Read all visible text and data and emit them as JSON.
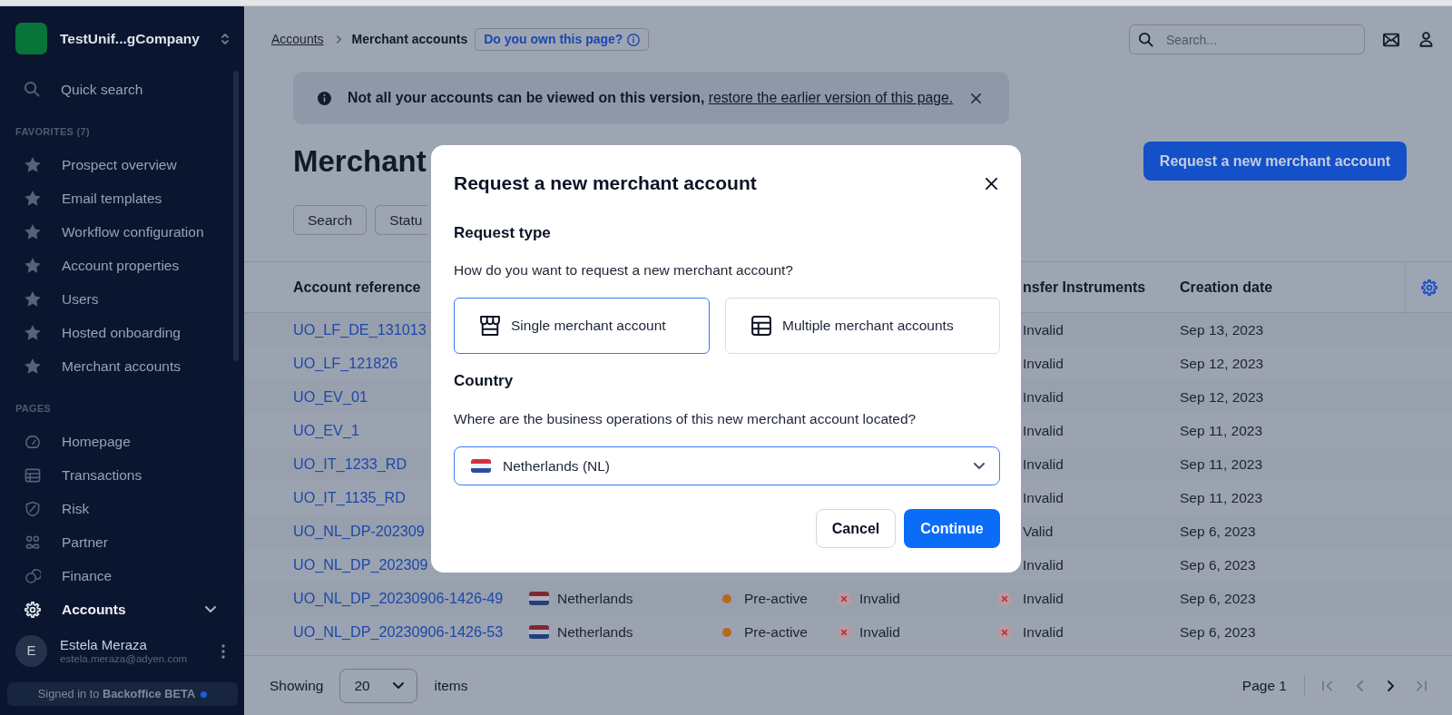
{
  "sidebar": {
    "account_name": "TestUnif...gCompany",
    "quick_search": "Quick search",
    "sections": [
      {
        "title": "FAVORITES (7)",
        "items": [
          {
            "label": "Prospect overview",
            "selected": false
          },
          {
            "label": "Email templates",
            "selected": false
          },
          {
            "label": "Workflow configuration",
            "selected": false
          },
          {
            "label": "Account properties",
            "selected": false
          },
          {
            "label": "Users",
            "selected": false
          },
          {
            "label": "Hosted onboarding",
            "selected": false
          },
          {
            "label": "Merchant accounts",
            "selected": false
          }
        ]
      },
      {
        "title": "PAGES",
        "items": [
          {
            "label": "Homepage",
            "selected": false
          },
          {
            "label": "Transactions",
            "selected": false
          },
          {
            "label": "Risk",
            "selected": false
          },
          {
            "label": "Partner",
            "selected": false
          },
          {
            "label": "Finance",
            "selected": false
          },
          {
            "label": "Accounts",
            "selected": true,
            "expanded": false
          }
        ]
      }
    ],
    "user": {
      "initial": "E",
      "name": "Estela Meraza",
      "email": "estela.meraza@adyen.com"
    },
    "signed_in": "Signed in to **Backoffice BETA**"
  },
  "topbar": {
    "breadcrumb": [
      {
        "label": "Accounts",
        "kind": "link"
      },
      {
        "label": "Merchant accounts",
        "kind": "current"
      }
    ],
    "ownership_button": "Do you own this page?",
    "search": {
      "placeholder": "Search..."
    }
  },
  "banner": {
    "message": "Not all your accounts can be viewed on this version,",
    "link": "restore the earlier version of this page."
  },
  "page": {
    "title": "Merchant",
    "primary_button": "Request a new merchant account",
    "filters": [
      "Search",
      "Statu"
    ]
  },
  "table": {
    "columns": {
      "account_reference": "Account reference",
      "transfer_instruments": "nsfer Instruments",
      "creation_date": "Creation date"
    },
    "rows": [
      {
        "account_reference": "UO_LF_DE_131013",
        "transfer_instruments": {
          "text": "Invalid"
        },
        "creation_date": "Sep 13, 2023"
      },
      {
        "account_reference": "UO_LF_121826",
        "transfer_instruments": {
          "text": "Invalid"
        },
        "creation_date": "Sep 12, 2023"
      },
      {
        "account_reference": "UO_EV_01",
        "transfer_instruments": {
          "text": "Invalid"
        },
        "creation_date": "Sep 12, 2023"
      },
      {
        "account_reference": "UO_EV_1",
        "transfer_instruments": {
          "text": "Invalid"
        },
        "creation_date": "Sep 11, 2023"
      },
      {
        "account_reference": "UO_IT_1233_RD",
        "transfer_instruments": {
          "text": "Invalid"
        },
        "creation_date": "Sep 11, 2023"
      },
      {
        "account_reference": "UO_IT_1135_RD",
        "transfer_instruments": {
          "text": "Invalid"
        },
        "creation_date": "Sep 11, 2023"
      },
      {
        "account_reference": "UO_NL_DP-202309",
        "transfer_instruments": {
          "text": "Valid"
        },
        "creation_date": "Sep 6, 2023"
      },
      {
        "account_reference": "UO_NL_DP_202309",
        "transfer_instruments": {
          "text": "Invalid"
        },
        "creation_date": "Sep 6, 2023"
      },
      {
        "account_reference": "UO_NL_DP_20230906-1426-49",
        "column_2": "Netherlands",
        "column_3": {
          "text": "Pre-active",
          "color": "#b4691c"
        },
        "column_4": {
          "text": "Invalid",
          "valid": false
        },
        "transfer_instruments": {
          "text": "Invalid",
          "valid": false
        },
        "creation_date": "Sep 6, 2023"
      },
      {
        "account_reference": "UO_NL_DP_20230906-1426-53",
        "column_2": "Netherlands",
        "column_3": {
          "text": "Pre-active",
          "color": "#b4691c"
        },
        "column_4": {
          "text": "Invalid",
          "valid": false
        },
        "transfer_instruments": {
          "text": "Invalid",
          "valid": false
        },
        "creation_date": "Sep 6, 2023"
      }
    ]
  },
  "footer": {
    "showing_label": "Showing",
    "page_size": "20",
    "items_label": "items",
    "page": "Page 1",
    "pagination": [
      {
        "kind": "first",
        "disabled": true
      },
      {
        "kind": "previous",
        "disabled": true
      },
      {
        "kind": "next",
        "disabled": false
      },
      {
        "kind": "last",
        "disabled": true
      }
    ]
  },
  "modal": {
    "title": "Request a new merchant account",
    "request_type": {
      "heading": "Request type",
      "question": "How do you want to request a new merchant account?",
      "options": [
        {
          "label": "Single merchant account",
          "selected": true
        },
        {
          "label": "Multiple merchant accounts",
          "selected": false
        }
      ]
    },
    "country": {
      "heading": "Country",
      "question": "Where are the business operations of this new merchant account located?",
      "value": "Netherlands (NL)"
    },
    "buttons": [
      {
        "label": "Cancel",
        "kind": "secondary"
      },
      {
        "label": "Continue",
        "kind": "primary"
      }
    ]
  }
}
